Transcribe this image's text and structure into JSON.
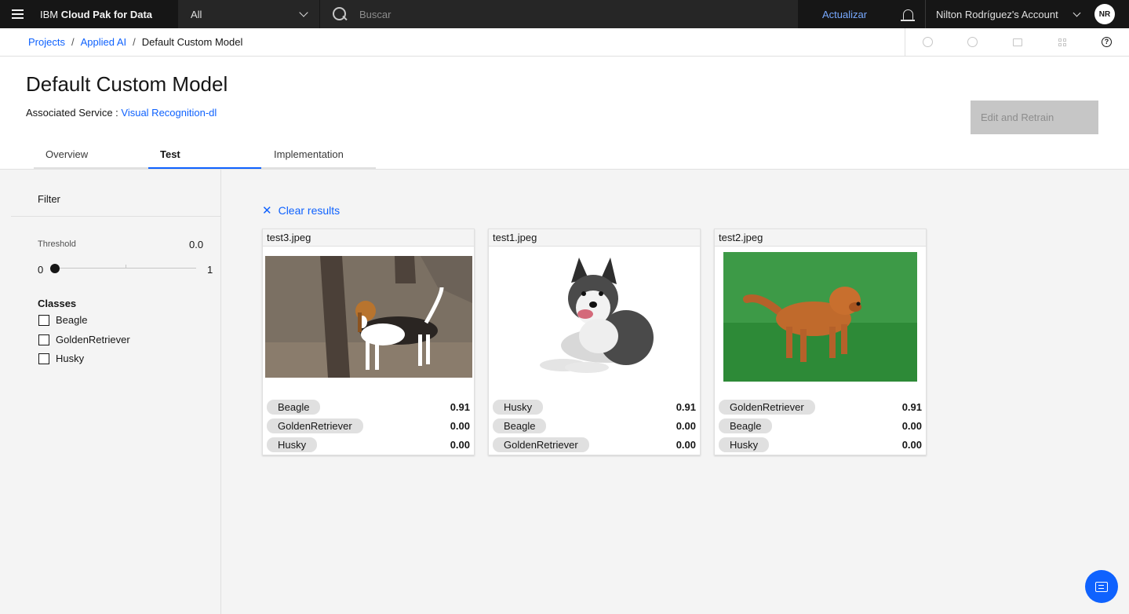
{
  "topbar": {
    "brand_prefix": "IBM ",
    "brand_bold": "Cloud Pak for Data",
    "scope": "All",
    "search_placeholder": "Buscar",
    "upgrade": "Actualizar",
    "account": "Nilton Rodríguez's Account",
    "avatar": "NR"
  },
  "breadcrumb": {
    "items": [
      "Projects",
      "Applied AI"
    ],
    "current": "Default Custom Model",
    "separator": "/"
  },
  "header": {
    "title": "Default Custom Model",
    "assoc_label": "Associated Service : ",
    "assoc_link": "Visual Recognition-dl",
    "retrain_button": "Edit and Retrain",
    "tabs": [
      "Overview",
      "Test",
      "Implementation"
    ],
    "active_tab": "Test"
  },
  "sidebar": {
    "filter": "Filter",
    "threshold_label": "Threshold",
    "threshold_value": "0.0",
    "slider_min": "0",
    "slider_max": "1",
    "classes_heading": "Classes",
    "classes": [
      "Beagle",
      "GoldenRetriever",
      "Husky"
    ]
  },
  "main": {
    "clear_results": "Clear results",
    "cards": [
      {
        "file": "test3.jpeg",
        "results": [
          {
            "label": "Beagle",
            "score": "0.91"
          },
          {
            "label": "GoldenRetriever",
            "score": "0.00"
          },
          {
            "label": "Husky",
            "score": "0.00"
          }
        ]
      },
      {
        "file": "test1.jpeg",
        "results": [
          {
            "label": "Husky",
            "score": "0.91"
          },
          {
            "label": "Beagle",
            "score": "0.00"
          },
          {
            "label": "GoldenRetriever",
            "score": "0.00"
          }
        ]
      },
      {
        "file": "test2.jpeg",
        "results": [
          {
            "label": "GoldenRetriever",
            "score": "0.91"
          },
          {
            "label": "Beagle",
            "score": "0.00"
          },
          {
            "label": "Husky",
            "score": "0.00"
          }
        ]
      }
    ]
  },
  "colors": {
    "accent": "#0f62fe",
    "topbar_bg": "#161616",
    "link_topbar": "#78a9ff"
  }
}
